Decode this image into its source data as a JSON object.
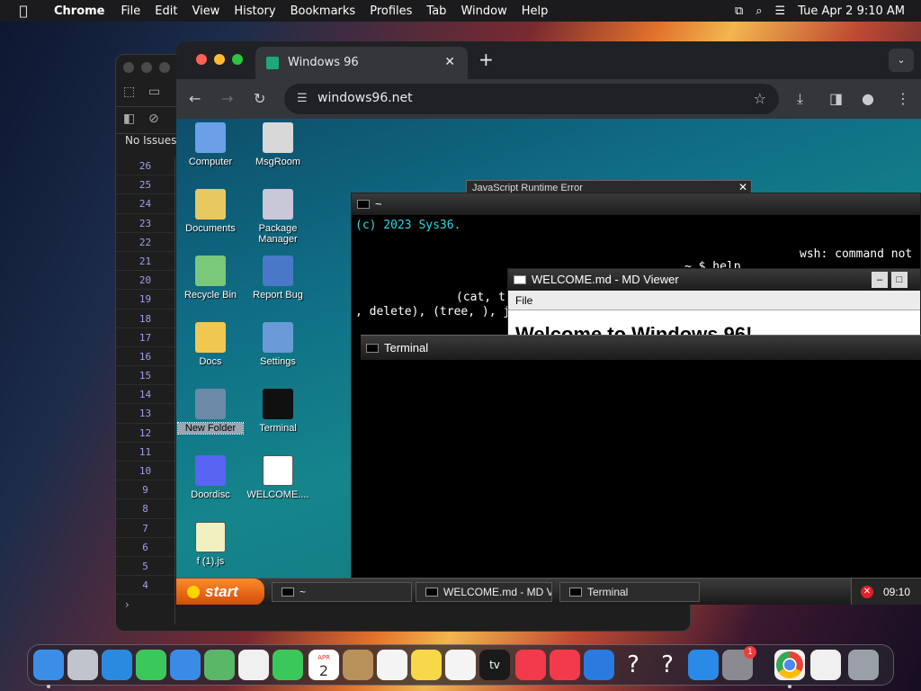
{
  "menubar": {
    "apple_glyph": "",
    "items": [
      "Chrome",
      "File",
      "Edit",
      "View",
      "History",
      "Bookmarks",
      "Profiles",
      "Tab",
      "Window",
      "Help"
    ],
    "datetime": "Tue Apr 2  9:10 AM"
  },
  "devtools": {
    "issues_label": "No Issues",
    "line_numbers": [
      "26",
      "25",
      "24",
      "23",
      "22",
      "21",
      "20",
      "19",
      "18",
      "17",
      "16",
      "15",
      "14",
      "13",
      "12",
      "11",
      "10",
      "9",
      "8",
      "7",
      "6",
      "5",
      "4"
    ]
  },
  "browser": {
    "tab_title": "Windows 96",
    "url": "windows96.net"
  },
  "desktop": {
    "icons": [
      {
        "label": "Computer",
        "color": "#6aa0e8"
      },
      {
        "label": "MsgRoom",
        "color": "#d8d8d8"
      },
      {
        "label": "Documents",
        "color": "#e8c860"
      },
      {
        "label": "Package Manager",
        "color": "#c8c8d8"
      },
      {
        "label": "Recycle Bin",
        "color": "#7ac87a"
      },
      {
        "label": "Report Bug",
        "color": "#4a78c8"
      },
      {
        "label": "Docs",
        "color": "#f0c850"
      },
      {
        "label": "Settings",
        "color": "#6a9ad8"
      },
      {
        "label": "New Folder",
        "color": "#6a8aa8"
      },
      {
        "label": "Terminal",
        "color": "#101010"
      },
      {
        "label": "Doordisc",
        "color": "#5865f2"
      },
      {
        "label": "WELCOME....",
        "color": "#ffffff"
      },
      {
        "label": "f (1).js",
        "color": "#f0f0c0"
      }
    ]
  },
  "windows": {
    "error_title": "JavaScript Runtime Error",
    "shell": {
      "title": "~",
      "line1": "(c) 2023 Sys36.",
      "line2": "wsh: command not",
      "line3": "~ $ help",
      "line4": "(cat, t",
      "line5": ", delete), (tree, ), j"
    },
    "md_viewer": {
      "title": "WELCOME.md - MD Viewer",
      "menu_file": "File",
      "heading_partial": "Welcome to Windows 96!"
    },
    "terminal": {
      "title": "Terminal"
    }
  },
  "taskbar": {
    "start_label": "start",
    "tasks": [
      "~",
      "WELCOME.md - MD Vi...",
      "Terminal"
    ],
    "clock": "09:10"
  },
  "dock": {
    "apps": [
      {
        "name": "Finder",
        "color": "#3a8ee6"
      },
      {
        "name": "Launchpad",
        "color": "#c0c4cc"
      },
      {
        "name": "Safari",
        "color": "#2a8ae0"
      },
      {
        "name": "Messages",
        "color": "#3ac85a"
      },
      {
        "name": "Mail",
        "color": "#3a8ae8"
      },
      {
        "name": "Maps",
        "color": "#58b868"
      },
      {
        "name": "Photos",
        "color": "#f0f0f0"
      },
      {
        "name": "FaceTime",
        "color": "#3ac85a"
      },
      {
        "name": "Calendar",
        "color": "#ffffff"
      },
      {
        "name": "Contacts",
        "color": "#b8905a"
      },
      {
        "name": "Reminders",
        "color": "#f4f4f4"
      },
      {
        "name": "Notes",
        "color": "#f8d848"
      },
      {
        "name": "Freeform",
        "color": "#f4f4f4"
      },
      {
        "name": "Apple TV",
        "color": "#1a1a1a"
      },
      {
        "name": "Music",
        "color": "#f23a4a"
      },
      {
        "name": "News",
        "color": "#f23a4a"
      },
      {
        "name": "Keynote",
        "color": "#2a7ae0"
      },
      {
        "name": "Unknown app",
        "color": "#00000000"
      },
      {
        "name": "Unknown app",
        "color": "#00000000"
      },
      {
        "name": "App Store",
        "color": "#2a8ae8"
      },
      {
        "name": "System Settings",
        "color": "#8a8a90"
      },
      {
        "name": "Chrome",
        "color": "#f0f0f0"
      },
      {
        "name": "Document",
        "color": "#f0f0f0"
      },
      {
        "name": "Trash",
        "color": "#9aa0a8"
      }
    ],
    "calendar_month": "APR",
    "calendar_day": "2",
    "tv_label": "tv",
    "settings_badge": "1"
  }
}
